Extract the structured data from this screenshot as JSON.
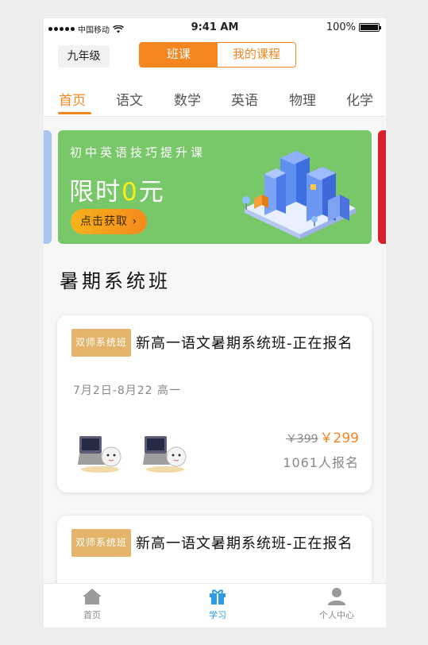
{
  "status_bar": {
    "carrier": "中国移动",
    "time": "9:41 AM",
    "battery": "100%"
  },
  "header": {
    "grade": "九年级",
    "segments": [
      "班课",
      "我的课程"
    ],
    "tabs": [
      "首页",
      "语文",
      "数学",
      "英语",
      "物理",
      "化学"
    ]
  },
  "banner": {
    "subtitle": "初中英语技巧提升课",
    "headline_prefix": "限时",
    "headline_highlight": "0",
    "headline_suffix": "元",
    "cta": "点击获取 ›"
  },
  "section_title": "暑期系统班",
  "courses": [
    {
      "badge": "双师系统班",
      "title": "新高一语文暑期系统班-正在报名",
      "meta": "7月2日-8月22 高一",
      "old_price": "￥399",
      "price": "￥299",
      "enroll": "1061人报名"
    },
    {
      "badge": "双师系统班",
      "title": "新高一语文暑期系统班-正在报名"
    }
  ],
  "bottom_nav": [
    "首页",
    "学习",
    "个人中心"
  ],
  "colors": {
    "accent": "#f5861f",
    "banner": "#78c86a",
    "nav_active": "#2c9be3",
    "badge": "#e3b469"
  }
}
